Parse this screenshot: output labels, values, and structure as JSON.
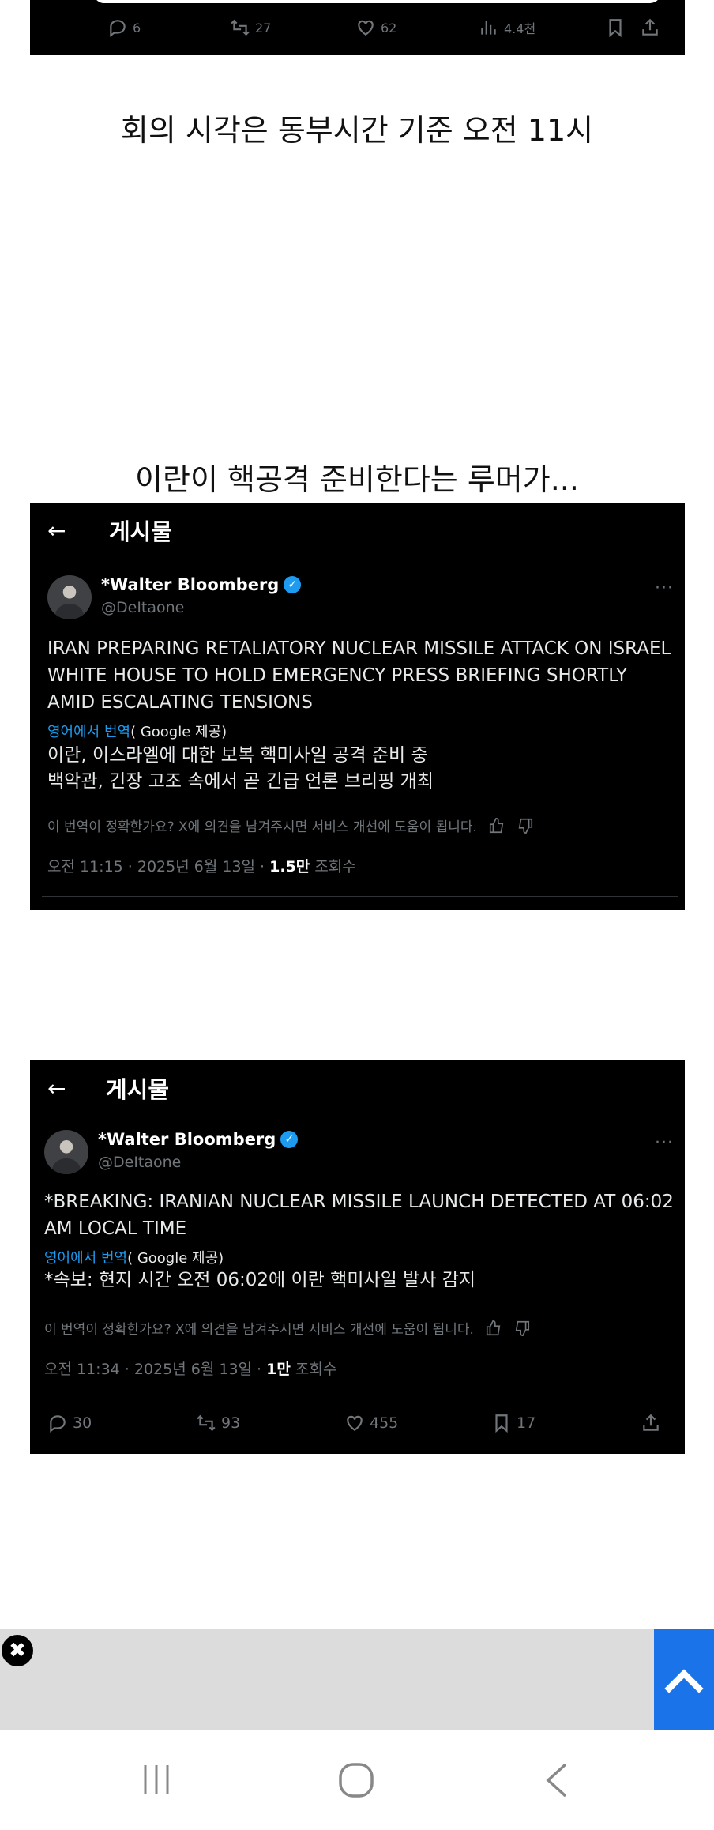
{
  "top_tweet": {
    "replies": "6",
    "reposts": "27",
    "likes": "62",
    "views": "4.4천"
  },
  "caption1": "회의 시각은 동부시간 기준 오전 11시",
  "caption2": "이란이 핵공격 준비한다는 루머가...",
  "post1": {
    "header_title": "게시물",
    "display_name": "*Walter Bloomberg",
    "handle": "@DeItaone",
    "text_en": "IRAN PREPARING RETALIATORY NUCLEAR MISSILE ATTACK ON ISRAEL WHITE HOUSE TO HOLD EMERGENCY PRESS BRIEFING SHORTLY AMID ESCALATING TENSIONS",
    "translate_link": "영어에서 번역",
    "translate_by": "( Google 제공)",
    "text_ko_line1": "이란, 이스라엘에 대한 보복 핵미사일 공격 준비 중",
    "text_ko_line2": "백악관, 긴장 고조 속에서 곧 긴급 언론 브리핑 개최",
    "feedback": "이 번역이 정확한가요? X에 의견을 남겨주시면 서비스 개선에 도움이 됩니다.",
    "timestamp": "오전 11:15 · 2025년 6월 13일 · ",
    "views_count": "1.5만",
    "views_label": " 조회수"
  },
  "post2": {
    "header_title": "게시물",
    "display_name": "*Walter Bloomberg",
    "handle": "@DeItaone",
    "text_en": "*BREAKING: IRANIAN NUCLEAR MISSILE LAUNCH DETECTED AT 06:02 AM LOCAL TIME",
    "translate_link": "영어에서 번역",
    "translate_by": "( Google 제공)",
    "text_ko": "*속보: 현지 시간 오전 06:02에 이란 핵미사일 발사 감지",
    "feedback": "이 번역이 정확한가요? X에 의견을 남겨주시면 서비스 개선에 도움이 됩니다.",
    "timestamp": "오전 11:34 · 2025년 6월 13일 · ",
    "views_count": "1만",
    "views_label": " 조회수",
    "replies": "30",
    "reposts": "93",
    "likes": "455",
    "bookmarks": "17"
  },
  "icons": {
    "ad_close": "✖",
    "back_arrow": "←",
    "more": "···"
  }
}
